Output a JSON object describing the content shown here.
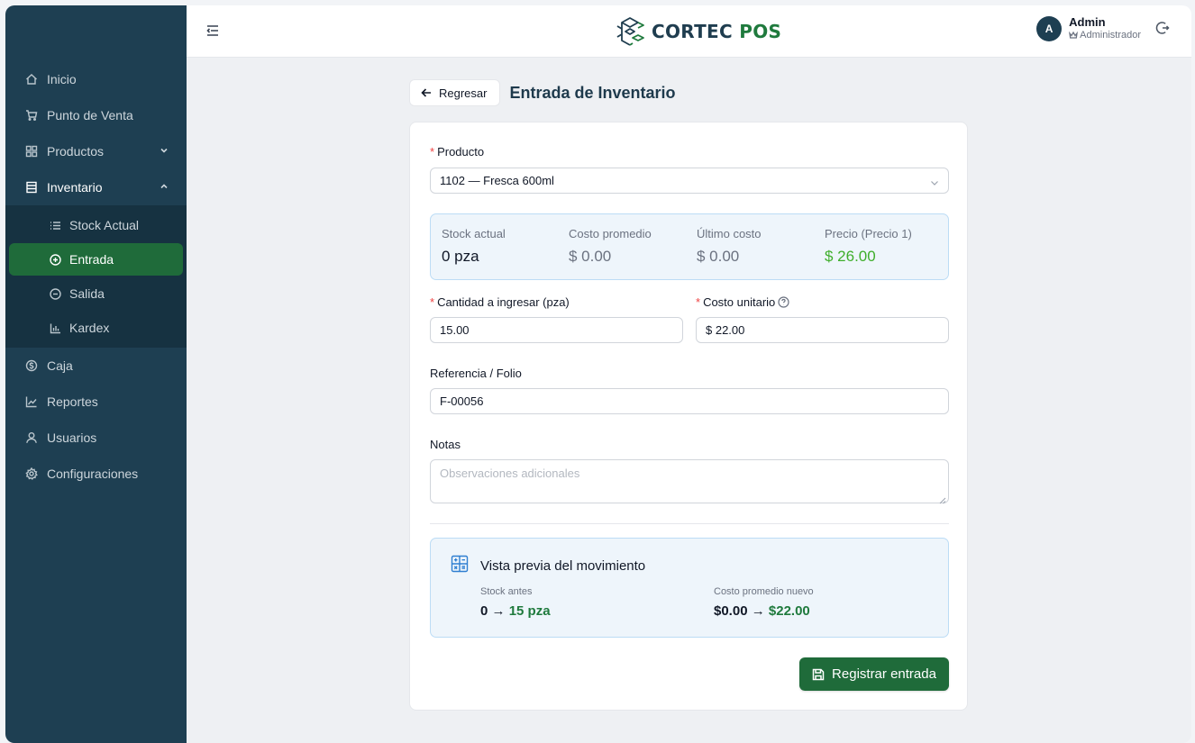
{
  "brand": {
    "part1": "CORTEC",
    "part2": "POS"
  },
  "user": {
    "initial": "A",
    "name": "Admin",
    "role": "Administrador"
  },
  "sidebar": {
    "items": [
      {
        "label": "Inicio",
        "icon": "home-icon"
      },
      {
        "label": "Punto de Venta",
        "icon": "cart-icon"
      },
      {
        "label": "Productos",
        "icon": "grid-icon"
      },
      {
        "label": "Inventario",
        "icon": "inventory-icon"
      }
    ],
    "inventory_sub": [
      {
        "label": "Stock Actual",
        "icon": "list-icon"
      },
      {
        "label": "Entrada",
        "icon": "plus-circle-icon"
      },
      {
        "label": "Salida",
        "icon": "minus-circle-icon"
      },
      {
        "label": "Kardex",
        "icon": "bar-chart-icon"
      }
    ],
    "items_after": [
      {
        "label": "Caja",
        "icon": "dollar-icon"
      },
      {
        "label": "Reportes",
        "icon": "line-chart-icon"
      },
      {
        "label": "Usuarios",
        "icon": "user-icon"
      },
      {
        "label": "Configuraciones",
        "icon": "settings-icon"
      }
    ]
  },
  "page": {
    "back_label": "Regresar",
    "title": "Entrada de Inventario"
  },
  "form": {
    "product_label": "Producto",
    "product_value": "1102 — Fresca 600ml",
    "stats": [
      {
        "label": "Stock actual",
        "value": "0 pza"
      },
      {
        "label": "Costo promedio",
        "value": "$ 0.00"
      },
      {
        "label": "Último costo",
        "value": "$ 0.00"
      },
      {
        "label": "Precio (Precio 1)",
        "value": "$ 26.00"
      }
    ],
    "qty_label": "Cantidad a ingresar (pza)",
    "qty_value": "15.00",
    "cost_label": "Costo unitario",
    "cost_value": "$ 22.00",
    "ref_label": "Referencia / Folio",
    "ref_value": "F-00056",
    "notes_label": "Notas",
    "notes_placeholder": "Observaciones adicionales"
  },
  "preview": {
    "title": "Vista previa del movimiento",
    "stock_label": "Stock antes",
    "stock_before": "0 →",
    "stock_after": "15 pza",
    "cost_label": "Costo promedio nuevo",
    "cost_before": "$0.00 →",
    "cost_after": "$22.00"
  },
  "submit_label": "Registrar entrada",
  "colors": {
    "sidebar": "#1e3f52",
    "accent": "#1f6b3a",
    "price": "#3fae2b"
  }
}
